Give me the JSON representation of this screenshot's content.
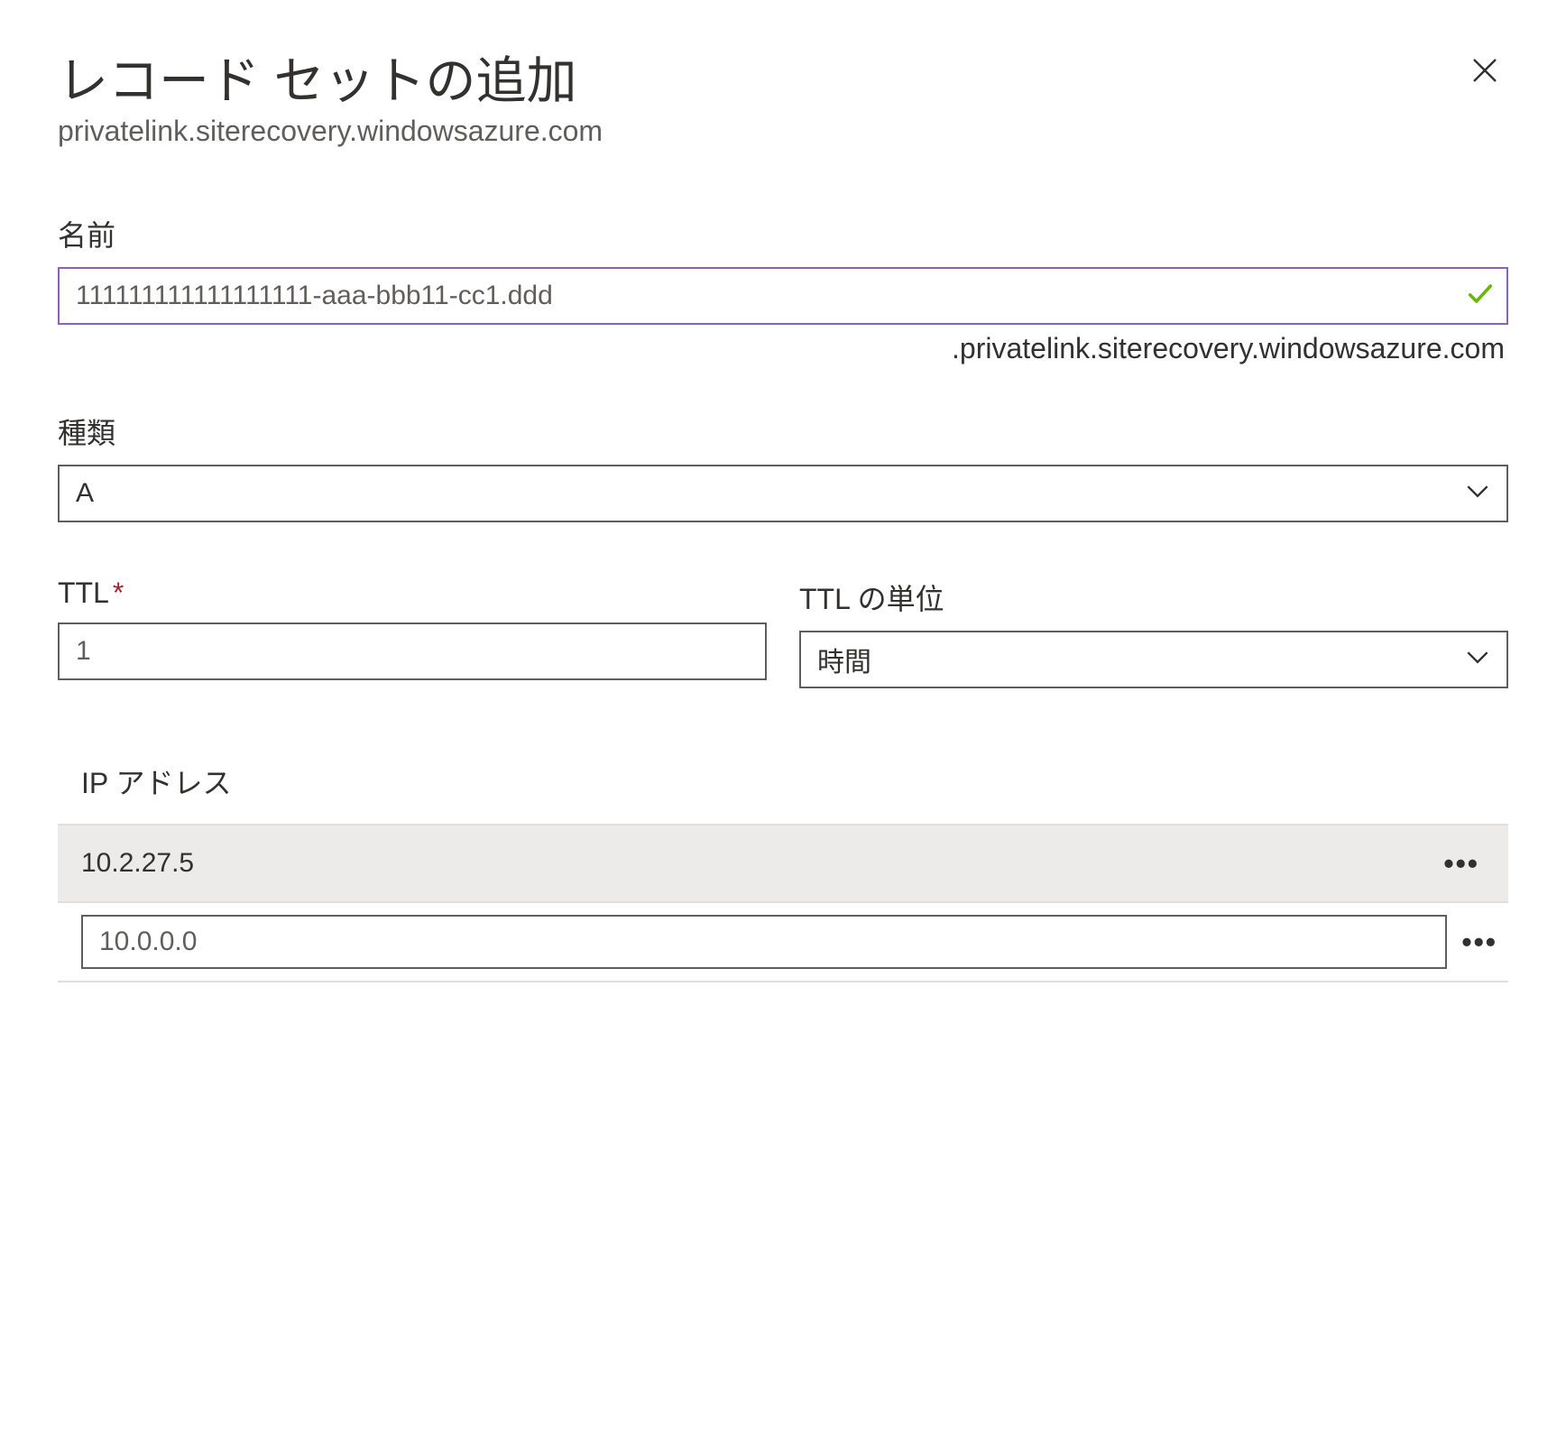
{
  "header": {
    "title": "レコード セットの追加",
    "subtitle": "privatelink.siterecovery.windowsazure.com"
  },
  "name_field": {
    "label": "名前",
    "value": "111111111111111111-aaa-bbb11-cc1.ddd",
    "suffix": ".privatelink.siterecovery.windowsazure.com"
  },
  "type_field": {
    "label": "種類",
    "value": "A"
  },
  "ttl_field": {
    "label": "TTL",
    "value": "1"
  },
  "ttl_unit_field": {
    "label": "TTL の単位",
    "value": "時間"
  },
  "ip_section": {
    "label": "IP アドレス",
    "rows": [
      {
        "value": "10.2.27.5"
      }
    ],
    "placeholder": "10.0.0.0"
  }
}
